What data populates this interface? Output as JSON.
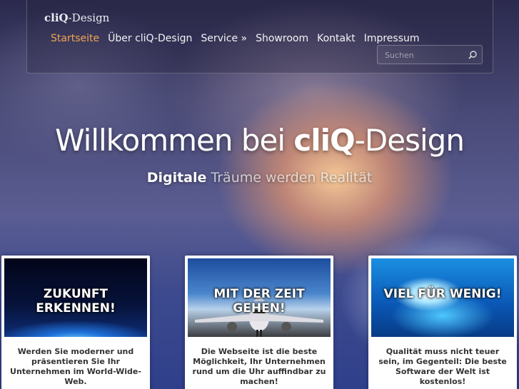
{
  "site": {
    "logo_prefix": "cliQ",
    "logo_suffix": "-Design"
  },
  "nav": {
    "items": [
      {
        "label": "Startseite",
        "active": true
      },
      {
        "label": "Über cliQ-Design",
        "active": false
      },
      {
        "label": "Service »",
        "active": false
      },
      {
        "label": "Showroom",
        "active": false
      },
      {
        "label": "Kontakt",
        "active": false
      },
      {
        "label": "Impressum",
        "active": false
      }
    ],
    "search_placeholder": "Suchen",
    "search_icon": "search-icon"
  },
  "hero": {
    "title_prefix": "Willkommen bei ",
    "title_brand": "cliQ",
    "title_suffix": "-Design",
    "subtitle_strong": "Digitale",
    "subtitle_light": " Träume werden Realität"
  },
  "cards": [
    {
      "image_label": "ZUKUNFT ERKENNEN!",
      "text": "Werden Sie moderner und präsentieren Sie Ihr Unternehmen im World-Wide-Web."
    },
    {
      "image_label": "MIT DER ZEIT GEHEN!",
      "text": "Die Webseite ist die beste Möglichkeit, Ihr Unternehmen rund um die Uhr auffindbar zu machen!"
    },
    {
      "image_label": "VIEL FÜR WENIG!",
      "text": "Qualität muss nicht teuer sein, im Gegenteil: Die beste Software der Welt ist kostenlos!"
    }
  ],
  "colors": {
    "active_menu": "#f2a450",
    "card_bg": "#ffffff"
  }
}
